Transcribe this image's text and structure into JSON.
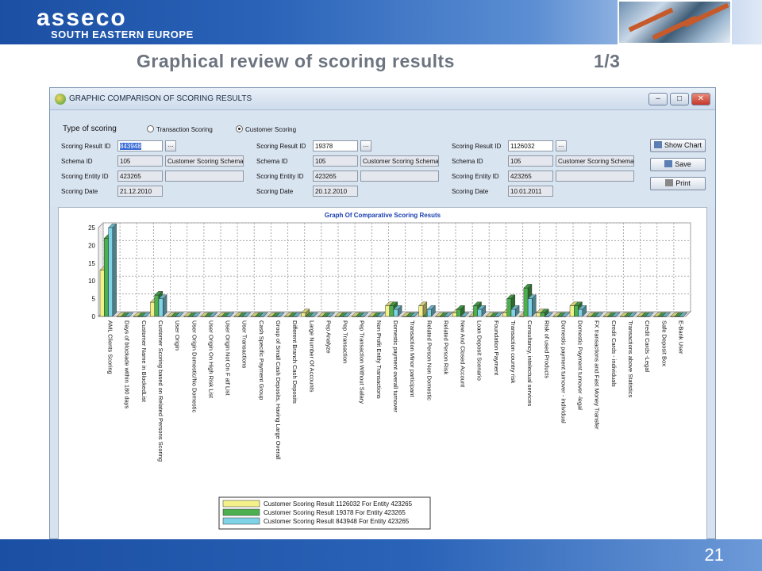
{
  "header": {
    "logo_text": "asseco",
    "logo_subtitle": "SOUTH EASTERN EUROPE",
    "title": "Graphical review of scoring results",
    "title_page": "1/3",
    "brand_color": "#1b4fa3"
  },
  "window": {
    "title": "GRAPHIC COMPARISON OF SCORING RESULTS",
    "controls": [
      "minimize",
      "maximize",
      "close"
    ]
  },
  "scoring_type": {
    "label": "Type of scoring",
    "options": [
      "Transaction Scoring",
      "Customer Scoring"
    ],
    "selected": "Customer Scoring"
  },
  "fields": {
    "labels": [
      "Scoring Result ID",
      "Schema ID",
      "Scoring Entity ID",
      "Scoring Date"
    ],
    "columns": [
      {
        "result_id": "843948",
        "schema_id": "105",
        "schema_name": "Customer Scoring Schema",
        "entity_id": "423265",
        "entity_name": "",
        "date": "21.12.2010"
      },
      {
        "result_id": "19378",
        "schema_id": "105",
        "schema_name": "Customer Scoring Schema",
        "entity_id": "423265",
        "entity_name": "",
        "date": "20.12.2010"
      },
      {
        "result_id": "1126032",
        "schema_id": "105",
        "schema_name": "Customer Scoring Schema",
        "entity_id": "423265",
        "entity_name": "",
        "date": "10.01.2011"
      }
    ],
    "lookup_label": "..."
  },
  "buttons": {
    "show_chart": "Show Chart",
    "save": "Save",
    "print": "Print"
  },
  "chart_data": {
    "type": "bar",
    "title": "Graph Of Comparative Scoring Resuts",
    "ylim": [
      0,
      25
    ],
    "yticks": [
      0,
      5,
      10,
      15,
      20,
      25
    ],
    "grid": true,
    "legend_position": "bottom-center",
    "categories": [
      "AML Clients Scoring",
      "Days of blockade within 180 days",
      "Customer Name in BlockedList",
      "Customer Scoring based on Related Persons Scoring",
      "User Origin",
      "User Origin Domestic/No Domestic",
      "User Origin On High Risk List",
      "User Origin Not On F atf List",
      "User Transactions",
      "Cash Specific Payment Group",
      "Group of Small Cash Deposits, Having Large Overall",
      "Different Branch Cash Deposits",
      "Large Number Of Accounts",
      "Pep Analyze",
      "Pep Transaction",
      "Pep Transaction Without Salary",
      "Non Profit Entity Transactions",
      "Domestic payment overall turnover",
      "Transaction Minor participant",
      "Related Person Non Domestic",
      "Related Person Risk",
      "New And Closed Account",
      "Loan Deposit Scenario",
      "Foundation Payment",
      "Transaction country risk",
      "Consultancy, intelectual services",
      "Risk of used Products",
      "Domestic payment turnover - individual",
      "Domestic Payment turnover -legal",
      "FX transactions and Fast Money Transfer",
      "Credit Cards - individuals",
      "Transactions above Statistics",
      "Credit Cards -Legal",
      "Safe Deposit Box",
      "E-Bank User"
    ],
    "series": [
      {
        "name": "Customer Scoring Result 843948 For Entity 423265",
        "color": "#7fd3e6",
        "values": [
          25,
          0,
          0,
          5,
          0,
          0,
          0,
          0,
          0,
          0,
          0,
          0,
          0,
          0,
          0,
          0,
          0,
          2,
          0,
          2,
          0,
          0,
          2,
          0,
          2,
          5,
          0,
          0,
          2,
          0,
          0,
          0,
          0,
          0,
          0
        ]
      },
      {
        "name": "Customer Scoring Result 19378 For Entity 423265",
        "color": "#4caf50",
        "values": [
          22,
          0,
          0,
          6,
          0,
          0,
          0,
          0,
          0,
          0,
          0,
          0,
          0,
          0,
          0,
          0,
          0,
          3,
          0,
          0,
          0,
          2,
          3,
          0,
          5,
          8,
          1,
          0,
          3,
          0,
          0,
          0,
          0,
          0,
          0
        ]
      },
      {
        "name": "Customer Scoring Result 1126032 For Entity 423265",
        "color": "#f3f08a",
        "values": [
          13,
          0,
          0,
          4,
          0,
          0,
          0,
          0,
          0,
          0,
          0,
          0,
          1,
          0,
          0,
          0,
          0,
          3,
          0,
          3,
          0,
          1,
          0,
          0,
          1,
          0,
          1,
          0,
          3,
          0,
          0,
          0,
          0,
          0,
          0
        ]
      }
    ],
    "legend_order": [
      2,
      1,
      0
    ]
  },
  "footer": {
    "page_number": "21"
  }
}
